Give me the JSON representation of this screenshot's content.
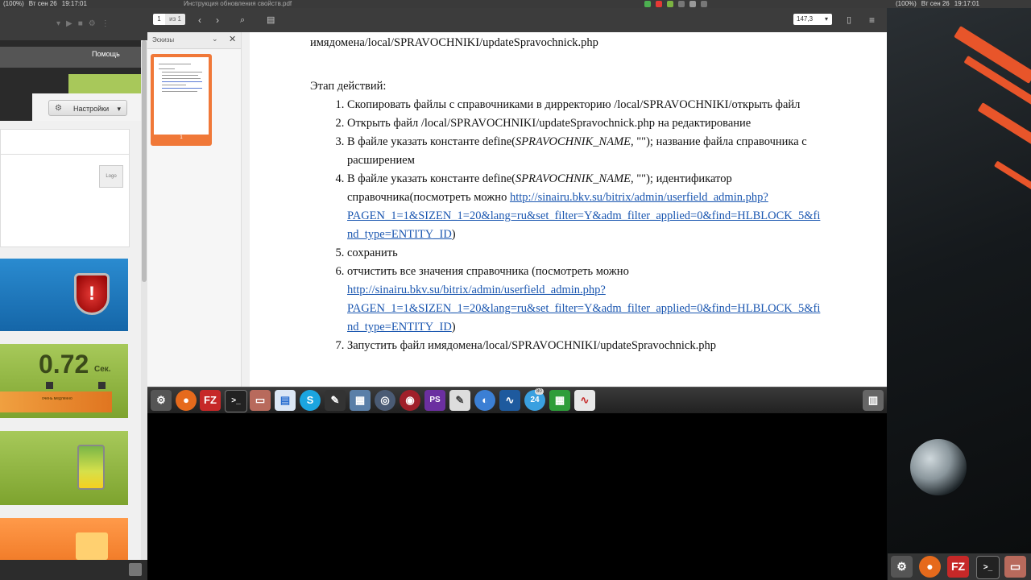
{
  "top_panel": {
    "window_title": "Инструкция обновления свойств.pdf",
    "left_text": "(100%)",
    "left_date": "Вт сен 26",
    "left_time": "19:17:01",
    "battery": "(100%)",
    "date": "Вт сен 26",
    "time": "19:17:01"
  },
  "left_app": {
    "help_label": "Помощь",
    "settings_label": "Настройки",
    "logo_text": "Logo",
    "speed_value": "0.72",
    "speed_unit": "Сек.",
    "speed_label": "очень медленно"
  },
  "toolbar": {
    "page_number": "1",
    "page_of": "из 1",
    "zoom": "147,3"
  },
  "sidebar": {
    "title": "Эскизы",
    "thumb_label": "1"
  },
  "doc": {
    "top_line": "имядомена/local/SPRAVOCHNIKI/updateSpravochnick.php",
    "heading": "Этап действий:",
    "item1": "Скопировать файлы с справочниками в дирректорию /local/SPRAVOCHNIKI/открыть файл",
    "item2": "Открыть файл /local/SPRAVOCHNIKI/updateSpravochnick.php на редактирование",
    "item3_pre": "В файле указать константе define(",
    "item3_const": "SPRAVOCHNIK_NAME",
    "item3_post": ", \"\"); название файла справочника с расширением",
    "item4_pre": "В файле указать константе define(",
    "item4_const": "SPRAVOCHNIK_NAME",
    "item4_post": ", \"\"); идентификатор справочника(посмотреть можно ",
    "item4_link1": "http://sinairu.bkv.su/bitrix/admin/userfield_admin.php?",
    "item4_link2": "PAGEN_1=1&SIZEN_1=20&lang=ru&set_filter=Y&adm_filter_applied=0&find=HLBLOCK_5&fi",
    "item4_link3": "nd_type=ENTITY_ID",
    "item4_close": ")",
    "item5": "сохранить",
    "item6_pre": "отчистить все значения справочника (посмотреть можно",
    "item6_link1": "http://sinairu.bkv.su/bitrix/admin/userfield_admin.php?",
    "item6_link2": "PAGEN_1=1&SIZEN_1=20&lang=ru&set_filter=Y&adm_filter_applied=0&find=HLBLOCK_5&fi",
    "item6_link3": "nd_type=ENTITY_ID",
    "item6_close": ")",
    "item7": "Запустить файл имядомена/local/SPRAVOCHNIKI/updateSpravochnick.php"
  },
  "dock": {
    "filezilla": "FZ",
    "terminal": ">_",
    "skype": "S",
    "phpstorm": "PS",
    "calendar_badge": "24",
    "badge_count": "80"
  },
  "colors": {
    "accent_orange": "#f07838",
    "link": "#1a56b0"
  }
}
